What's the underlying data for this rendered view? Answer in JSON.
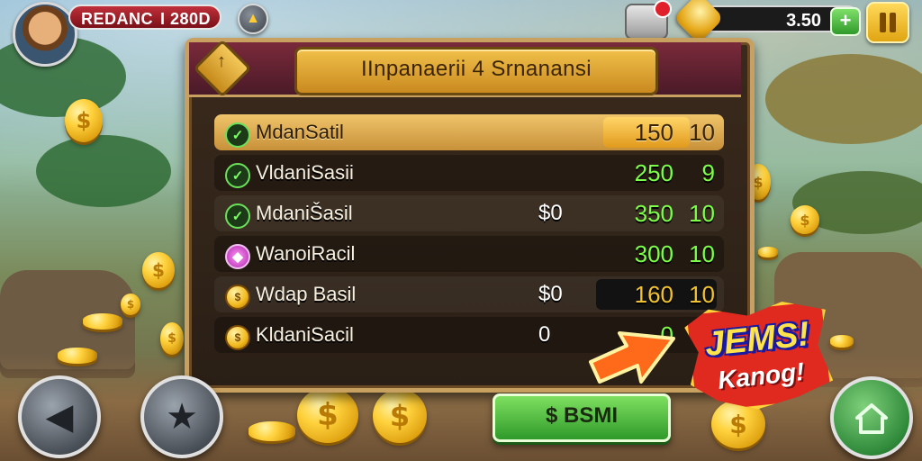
{
  "player": {
    "name": "REDANC",
    "score": "I 280D"
  },
  "currency": {
    "amount": "3.50",
    "add_label": "+"
  },
  "panel": {
    "title": "IInpanaerii 4 Srnanansi",
    "corner_badge_label": "↑"
  },
  "rows": [
    {
      "icon": "check-icon",
      "name": "MdanSatil",
      "price": "",
      "value": "150",
      "level": "10",
      "state": "selected"
    },
    {
      "icon": "check-icon",
      "name": "VldaniSasii",
      "price": "",
      "value": "250",
      "level": "9",
      "state": "normal"
    },
    {
      "icon": "check-icon",
      "name": "MdaniŠasil",
      "price": "$0",
      "value": "350",
      "level": "10",
      "state": "normal"
    },
    {
      "icon": "gem-icon",
      "name": "WanoiRacil",
      "price": "",
      "value": "300",
      "level": "10",
      "state": "normal"
    },
    {
      "icon": "coin-icon",
      "name": "Wdap Basil",
      "price": "$0",
      "value": "160",
      "level": "10",
      "state": "dark"
    },
    {
      "icon": "coin-icon",
      "name": "KldaniSacil",
      "price": "0",
      "value": "0",
      "level": "9",
      "state": "normal"
    }
  ],
  "buy_button": {
    "label": "$ BSMI"
  },
  "promo": {
    "line1": "JEMS!",
    "line2": "Kanog!"
  },
  "colors": {
    "accent_gold": "#f1c04a",
    "value_green": "#7dff4a",
    "panel_header": "#7a2a3a",
    "buy_green": "#2f9a2a",
    "promo_red": "#e02a20"
  }
}
